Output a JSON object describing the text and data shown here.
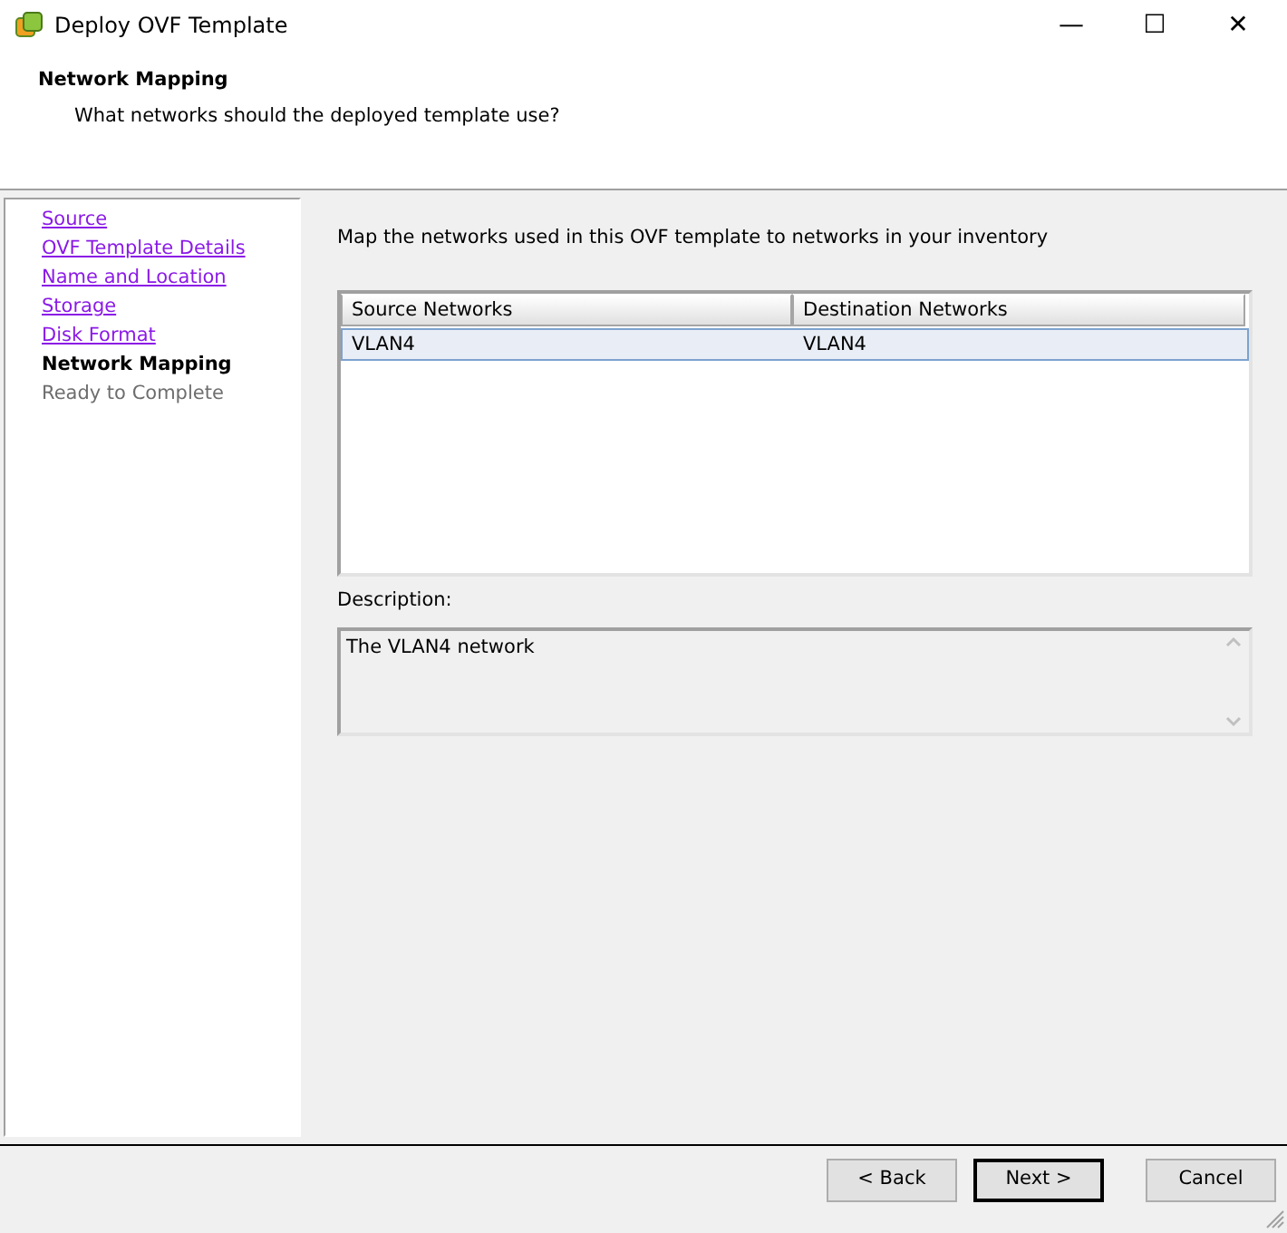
{
  "window": {
    "title": "Deploy OVF Template",
    "controls": [
      "—",
      "☐",
      "✕"
    ]
  },
  "header": {
    "title": "Network Mapping",
    "subtitle": "What networks should the deployed template use?"
  },
  "steps": [
    {
      "label": "Source",
      "kind": "done"
    },
    {
      "label": "OVF Template Details",
      "kind": "done"
    },
    {
      "label": "Name and Location",
      "kind": "done"
    },
    {
      "label": "Storage",
      "kind": "done"
    },
    {
      "label": "Disk Format",
      "kind": "done"
    },
    {
      "label": "Network Mapping",
      "kind": "current"
    },
    {
      "label": "Ready to Complete",
      "kind": "pending"
    }
  ],
  "instruction": "Map the networks used in this OVF template to networks in your inventory",
  "table": {
    "columns": [
      "Source Networks",
      "Destination Networks"
    ],
    "rows": [
      {
        "cells": [
          "VLAN4",
          "VLAN4"
        ],
        "selected": true
      }
    ]
  },
  "description": {
    "label": "Description:",
    "value": "The VLAN4 network"
  },
  "buttons": [
    {
      "label": "< Back",
      "default": false
    },
    {
      "label": "Next >",
      "default": true
    },
    {
      "label": "Cancel",
      "default": false
    }
  ]
}
